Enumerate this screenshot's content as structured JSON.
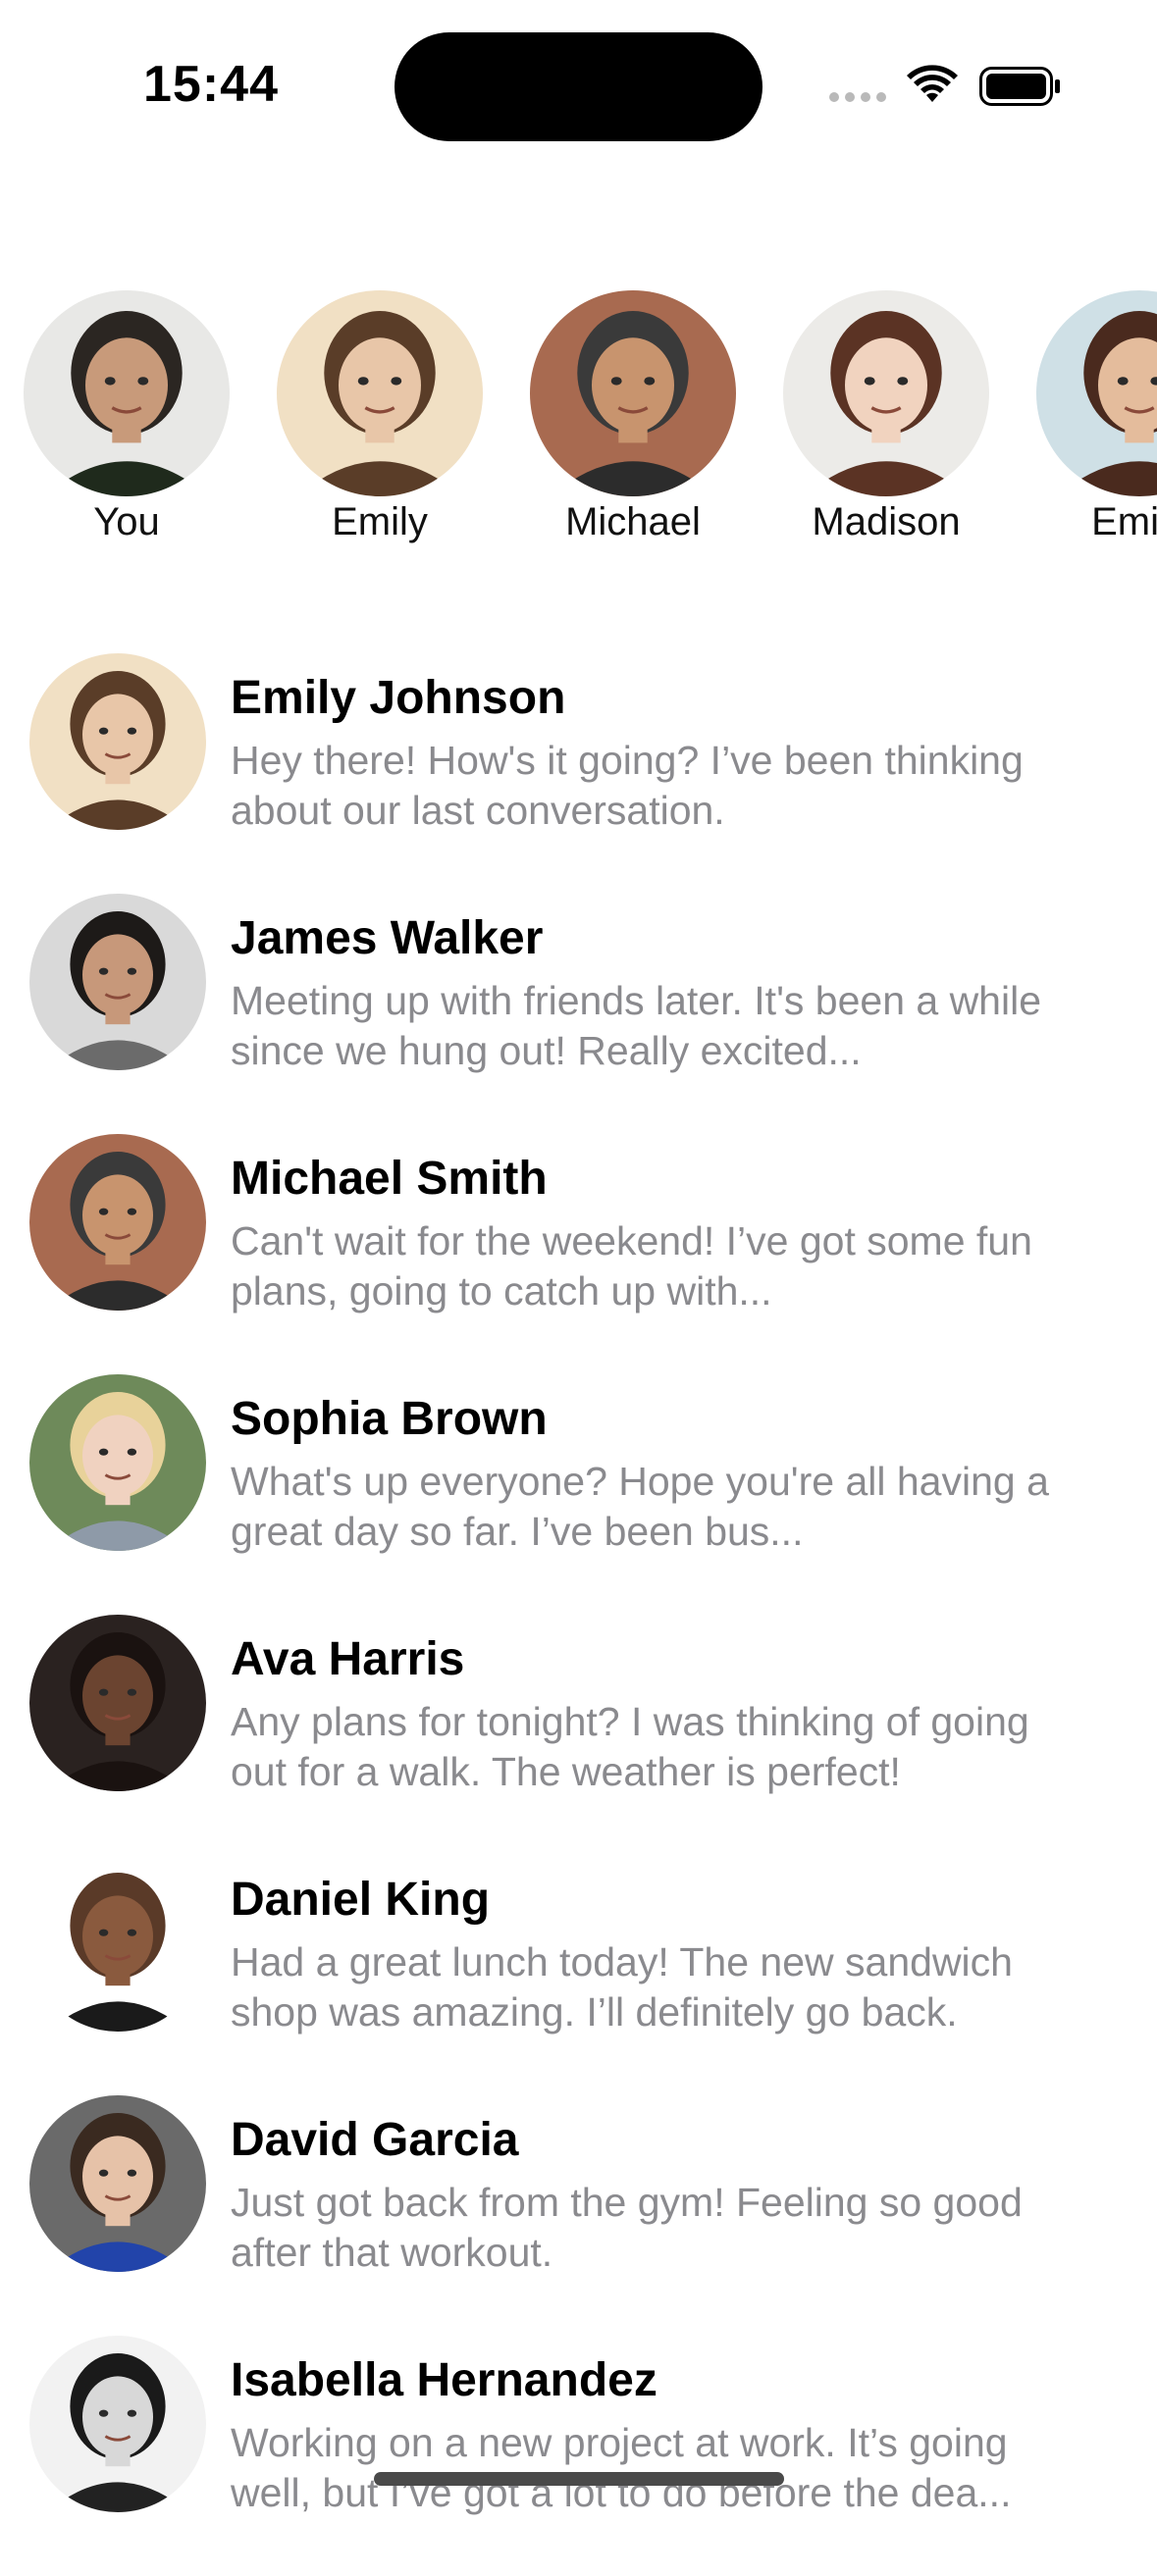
{
  "status_bar": {
    "time": "15:44",
    "icons": [
      "cellular-signal-icon",
      "wifi-icon",
      "battery-icon"
    ]
  },
  "stories": [
    {
      "label": "You",
      "skin": "#c89a7a",
      "hair": "#2b2622",
      "bg": "#e8e8e6",
      "shirt": "#1f2a1c"
    },
    {
      "label": "Emily",
      "skin": "#e8c6a8",
      "hair": "#5a3d28",
      "bg": "#f1e0c4",
      "shirt": "#5a3d28"
    },
    {
      "label": "Michael",
      "skin": "#c8946e",
      "hair": "#3a3a3a",
      "bg": "#a86a50",
      "shirt": "#2c2c2c"
    },
    {
      "label": "Madison",
      "skin": "#f1d3bf",
      "hair": "#5b3324",
      "bg": "#ecebe8",
      "shirt": "#5b3324"
    },
    {
      "label": "Emily",
      "skin": "#e4bc9c",
      "hair": "#4a2a1e",
      "bg": "#cfe0e6",
      "shirt": "#4a2a1e"
    }
  ],
  "chats": [
    {
      "name": "Emily Johnson",
      "preview": "Hey there! How's it going? I’ve been thinking about our last conversation.",
      "skin": "#e8c6a8",
      "hair": "#5a3d28",
      "bg": "#f1e0c4",
      "shirt": "#5a3d28"
    },
    {
      "name": "James Walker",
      "preview": "Meeting up with friends later. It's been a while since we hung out! Really excited...",
      "skin": "#c7987a",
      "hair": "#1d1a18",
      "bg": "#d9d9d9",
      "shirt": "#6b6b6b"
    },
    {
      "name": "Michael Smith",
      "preview": "Can't wait for the weekend! I’ve got some fun plans, going to catch up with...",
      "skin": "#c8946e",
      "hair": "#3a3a3a",
      "bg": "#a86a50",
      "shirt": "#2c2c2c"
    },
    {
      "name": "Sophia Brown",
      "preview": "What's up everyone? Hope you're all having a great day so far. I’ve been bus...",
      "skin": "#f0d2c0",
      "hair": "#e8d29a",
      "bg": "#6e8a5a",
      "shirt": "#8e9aa8"
    },
    {
      "name": "Ava Harris",
      "preview": "Any plans for tonight? I was thinking of going out for a walk. The weather is perfect!",
      "skin": "#6b4430",
      "hair": "#1a1210",
      "bg": "#2a2220",
      "shirt": "#1a1210"
    },
    {
      "name": "Daniel King",
      "preview": "Had a great lunch today! The new sandwich shop was amazing. I’ll definitely go back.",
      "skin": "#8a5a3e",
      "hair": "#5a3a28",
      "bg": "#ffffff",
      "shirt": "#1a1a1a"
    },
    {
      "name": "David Garcia",
      "preview": "Just got back from the gym! Feeling so good after that workout.",
      "skin": "#e6c2a8",
      "hair": "#3a2a20",
      "bg": "#6a6a6a",
      "shirt": "#2244aa"
    },
    {
      "name": "Isabella Hernandez",
      "preview": "Working on a new project at work. It’s going well, but I’ve got a lot to do before the dea...",
      "skin": "#d8d8d8",
      "hair": "#1a1a1a",
      "bg": "#f2f2f2",
      "shirt": "#222222"
    }
  ]
}
